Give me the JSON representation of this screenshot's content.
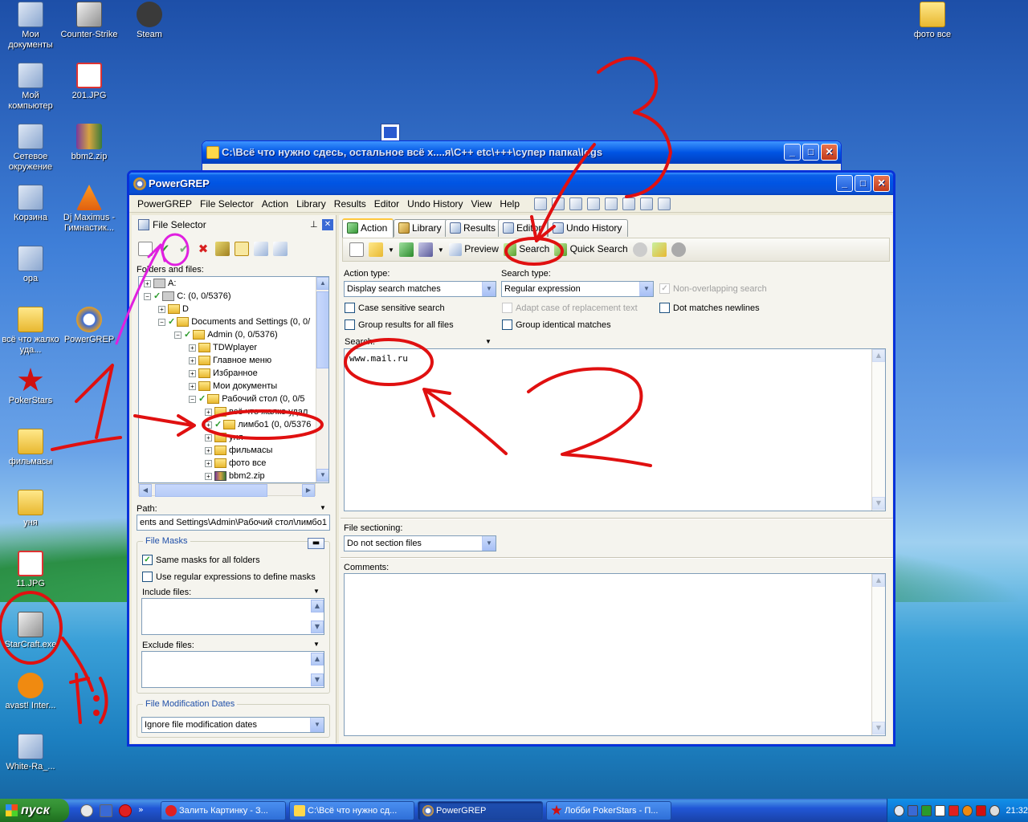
{
  "desktop": {
    "icons": [
      {
        "label": "Мои документы"
      },
      {
        "label": "Counter-Strike"
      },
      {
        "label": "Steam"
      },
      {
        "label": "фото все"
      },
      {
        "label": "Мой компьютер"
      },
      {
        "label": "201.JPG"
      },
      {
        "label": "Сетевое окружение"
      },
      {
        "label": "bbm2.zip"
      },
      {
        "label": "Корзина"
      },
      {
        "label": "Dj Maximus - Гимнастик..."
      },
      {
        "label": "ора"
      },
      {
        "label": "всё что жалко уда..."
      },
      {
        "label": "PowerGREP"
      },
      {
        "label": "PokerStars"
      },
      {
        "label": "фильмасы"
      },
      {
        "label": "уня"
      },
      {
        "label": "11.JPG"
      },
      {
        "label": "StarCraft.exe"
      },
      {
        "label": "avast! Inter..."
      },
      {
        "label": "White-Ra_..."
      }
    ]
  },
  "explorer_window": {
    "title": "C:\\Всё что нужно сдесь, остальное всё х....я\\C++ etc\\+++\\супер папка\\logs"
  },
  "app": {
    "title": "PowerGREP",
    "menu": [
      "PowerGREP",
      "File Selector",
      "Action",
      "Library",
      "Results",
      "Editor",
      "Undo History",
      "View",
      "Help"
    ],
    "file_selector": {
      "title": "File Selector",
      "folders_label": "Folders and files:",
      "tree": [
        {
          "label": "A:"
        },
        {
          "label": "C: (0, 0/5376)"
        },
        {
          "label": "D"
        },
        {
          "label": "Documents and Settings (0, 0/"
        },
        {
          "label": "Admin (0, 0/5376)"
        },
        {
          "label": "TDWplayer"
        },
        {
          "label": "Главное меню"
        },
        {
          "label": "Избранное"
        },
        {
          "label": "Мои документы"
        },
        {
          "label": "Рабочий стол (0, 0/5"
        },
        {
          "label": "всё что жалко удал"
        },
        {
          "label": "лимбо1 (0, 0/5376"
        },
        {
          "label": "уня"
        },
        {
          "label": "фильмасы"
        },
        {
          "label": "фото все"
        },
        {
          "label": "bbm2.zip"
        }
      ],
      "path_label": "Path:",
      "path_value": "ents and Settings\\Admin\\Рабочий стол\\лимбо1",
      "file_masks_title": "File Masks",
      "same_masks": "Same masks for all folders",
      "use_regex": "Use regular expressions to define masks",
      "include_label": "Include files:",
      "exclude_label": "Exclude files:",
      "dates_title": "File Modification Dates",
      "dates_value": "Ignore file modification dates"
    },
    "tabs": [
      "Action",
      "Library",
      "Results",
      "Editor",
      "Undo History"
    ],
    "action_toolbar": {
      "preview": "Preview",
      "search": "Search",
      "quick_search": "Quick Search"
    },
    "action": {
      "action_type_label": "Action type:",
      "action_type_value": "Display search matches",
      "search_type_label": "Search type:",
      "search_type_value": "Regular expression",
      "non_overlapping": "Non-overlapping search",
      "case_sensitive": "Case sensitive search",
      "adapt_case": "Adapt case of replacement text",
      "dot_newlines": "Dot matches newlines",
      "group_results": "Group results for all files",
      "group_identical": "Group identical matches",
      "search_label": "Search:",
      "search_value": "www.mail.ru",
      "file_sectioning_label": "File sectioning:",
      "file_sectioning_value": "Do not section files",
      "comments_label": "Comments:"
    }
  },
  "taskbar": {
    "start": "пуск",
    "items": [
      {
        "label": "Залить Картинку - З..."
      },
      {
        "label": "C:\\Всё что нужно сд..."
      },
      {
        "label": "PowerGREP"
      },
      {
        "label": "Лобби PokerStars - П..."
      }
    ],
    "clock": "21:32"
  },
  "annotations": {
    "numbers": [
      "1",
      "2",
      "3",
      "1:)"
    ]
  },
  "colors": {
    "xp_blue": "#0054e3",
    "annotation_red": "#e01010",
    "annotation_magenta": "#e020e0"
  }
}
